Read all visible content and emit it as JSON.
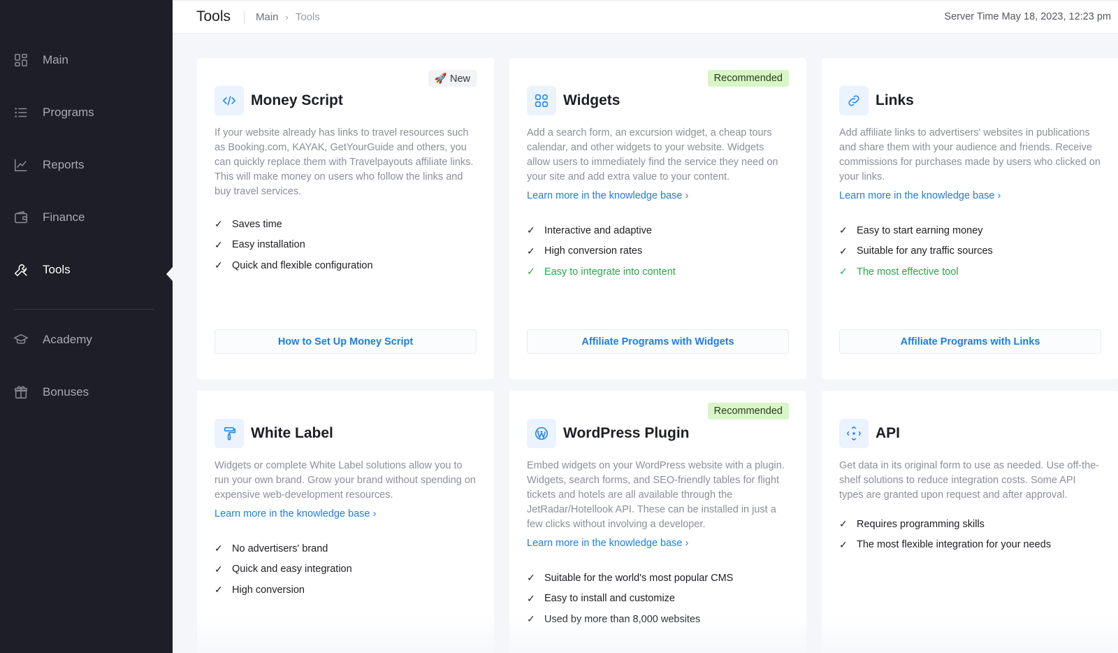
{
  "sidebar": {
    "items": [
      {
        "label": "Main",
        "icon": "dashboard-icon"
      },
      {
        "label": "Programs",
        "icon": "list-icon"
      },
      {
        "label": "Reports",
        "icon": "chart-icon"
      },
      {
        "label": "Finance",
        "icon": "wallet-icon"
      },
      {
        "label": "Tools",
        "icon": "wrench-icon",
        "active": true
      },
      {
        "label": "Academy",
        "icon": "graduation-cap-icon"
      },
      {
        "label": "Bonuses",
        "icon": "gift-icon"
      }
    ]
  },
  "header": {
    "title": "Tools",
    "breadcrumb": {
      "root": "Main",
      "current": "Tools"
    },
    "server_time": "Server Time May 18, 2023, 12:23 pm"
  },
  "cards": [
    {
      "title": "Money Script",
      "icon": "code-icon",
      "badge": "🚀 New",
      "description": "If your website already has links to travel resources such as Booking.com, KAYAK, GetYourGuide and others, you can quickly replace them with Travelpayouts affiliate links. This will make money on users who follow the links and buy travel services.",
      "features": [
        "Saves time",
        "Easy installation",
        "Quick and flexible configuration"
      ],
      "button": "How to Set Up Money Script"
    },
    {
      "title": "Widgets",
      "icon": "grid-icon",
      "badge": "Recommended",
      "description": "Add a search form, an excursion widget, a cheap tours calendar, and other widgets to your website. Widgets allow users to immediately find the service they need on your site and add extra value to your content.",
      "link": "Learn more in the knowledge base",
      "features": [
        "Interactive and adaptive",
        "High conversion rates",
        "Easy to integrate into content"
      ],
      "button": "Affiliate Programs with Widgets"
    },
    {
      "title": "Links",
      "icon": "link-icon",
      "description": "Add affiliate links to advertisers' websites in publications and share them with your audience and friends. Receive commissions for purchases made by users who clicked on your links.",
      "link": "Learn more in the knowledge base",
      "features": [
        "Easy to start earning money",
        "Suitable for any traffic sources",
        "The most effective tool"
      ],
      "button": "Affiliate Programs with Links"
    },
    {
      "title": "White Label",
      "icon": "paint-roller-icon",
      "description": "Widgets or complete White Label solutions allow you to run your own brand. Grow your brand without spending on expensive web-development resources.",
      "link": "Learn more in the knowledge base",
      "features": [
        "No advertisers' brand",
        "Quick and easy integration",
        "High conversion"
      ]
    },
    {
      "title": "WordPress Plugin",
      "icon": "wordpress-icon",
      "badge": "Recommended",
      "description": "Embed widgets on your WordPress website with a plugin. Widgets, search forms, and SEO-friendly tables for flight tickets and hotels are all available through the JetRadar/Hotellook API. These can be installed in just a few clicks without involving a developer.",
      "link": "Learn more in the knowledge base",
      "features": [
        "Suitable for the world's most popular CMS",
        "Easy to install and customize",
        "Used by more than 8,000 websites"
      ]
    },
    {
      "title": "API",
      "icon": "api-icon",
      "description": "Get data in its original form to use as needed. Use off-the-shelf solutions to reduce integration costs. Some API types are granted upon request and after approval.",
      "features": [
        "Requires programming skills",
        "The most flexible integration for your needs"
      ]
    }
  ],
  "colors": {
    "sidebar_bg": "#1d1e27",
    "accent": "#1a7fe0",
    "badge_recommended": "#d8f6c6",
    "feature_green": "#2aa64a"
  }
}
